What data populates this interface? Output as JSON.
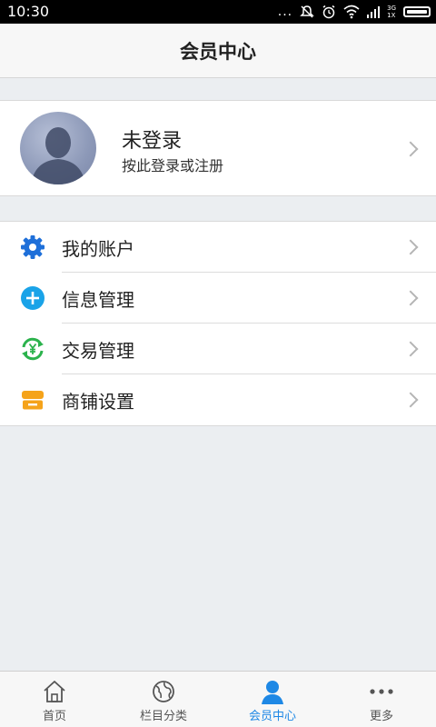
{
  "status_bar": {
    "time": "10:30",
    "dots": "...",
    "network_top": "3G",
    "network_bottom": "1X"
  },
  "header": {
    "title": "会员中心"
  },
  "profile": {
    "name": "未登录",
    "subtitle": "按此登录或注册"
  },
  "menu": {
    "items": [
      {
        "label": "我的账户",
        "icon": "gear-icon",
        "color": "#1e6fd9"
      },
      {
        "label": "信息管理",
        "icon": "plus-circle-icon",
        "color": "#1aa3e8"
      },
      {
        "label": "交易管理",
        "icon": "yen-exchange-icon",
        "color": "#2bb24c"
      },
      {
        "label": "商铺设置",
        "icon": "store-icon",
        "color": "#f5a31a"
      }
    ]
  },
  "tabbar": {
    "tabs": [
      {
        "label": "首页",
        "icon": "home-icon",
        "active": false
      },
      {
        "label": "栏目分类",
        "icon": "globe-icon",
        "active": false
      },
      {
        "label": "会员中心",
        "icon": "person-icon",
        "active": true
      },
      {
        "label": "更多",
        "icon": "more-dots-icon",
        "active": false
      }
    ],
    "active_color": "#1e88e5"
  }
}
